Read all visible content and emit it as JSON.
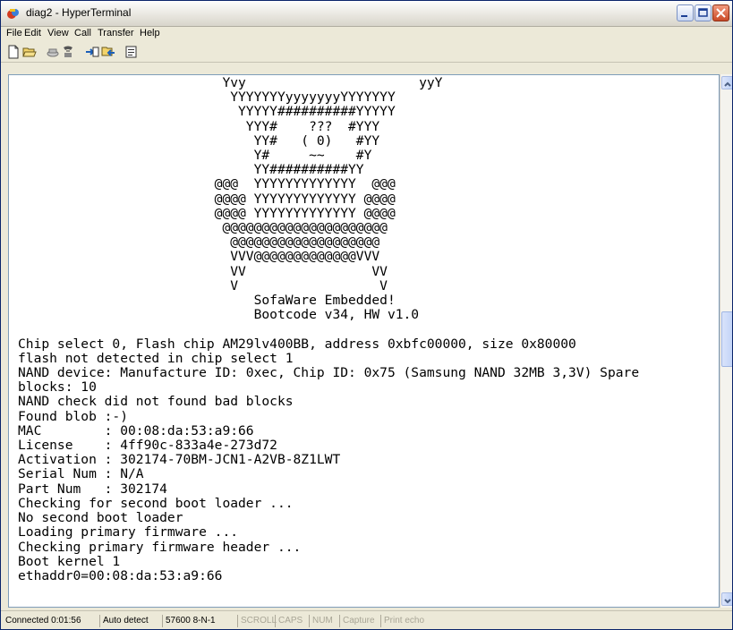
{
  "window": {
    "title": "diag2 - HyperTerminal"
  },
  "menu": [
    "File",
    "Edit",
    "View",
    "Call",
    "Transfer",
    "Help"
  ],
  "toolbar": [
    "new-icon",
    "open-icon",
    "disconnect-icon",
    "dial-icon",
    "send-icon",
    "receive-icon",
    "properties-icon"
  ],
  "terminal": {
    "text": "                          Yvy                      yyY\n                           YYYYYYYyyyyyyyYYYYYYY\n                            YYYYY##########YYYYY\n                             YYY#    ???  #YYY\n                              YY#   ( 0)   #YY\n                              Y#     ~~    #Y\n                              YY##########YY\n                         @@@  YYYYYYYYYYYYY  @@@\n                         @@@@ YYYYYYYYYYYYY @@@@\n                         @@@@ YYYYYYYYYYYYY @@@@\n                          @@@@@@@@@@@@@@@@@@@@@\n                           @@@@@@@@@@@@@@@@@@@\n                           VVV@@@@@@@@@@@@@VVV\n                           VV                VV\n                           V                  V\n                              SofaWare Embedded!\n                              Bootcode v34, HW v1.0\n\nChip select 0, Flash chip AM29lv400BB, address 0xbfc00000, size 0x80000\nflash not detected in chip select 1\nNAND device: Manufacture ID: 0xec, Chip ID: 0x75 (Samsung NAND 32MB 3,3V) Spare\nblocks: 10\nNAND check did not found bad blocks\nFound blob :-)\nMAC        : 00:08:da:53:a9:66\nLicense    : 4ff90c-833a4e-273d72\nActivation : 302174-70BM-JCN1-A2VB-8Z1LWT\nSerial Num : N/A\nPart Num   : 302174\nChecking for second boot loader ...\nNo second boot loader\nLoading primary firmware ...\nChecking primary firmware header ...\nBoot kernel 1\nethaddr0=00:08:da:53:a9:66"
  },
  "status": {
    "connected": "Connected 0:01:56",
    "detect": "Auto detect",
    "settings": "57600 8-N-1",
    "scroll": "SCROLL",
    "caps": "CAPS",
    "num": "NUM",
    "capture": "Capture",
    "print_echo": "Print echo"
  }
}
